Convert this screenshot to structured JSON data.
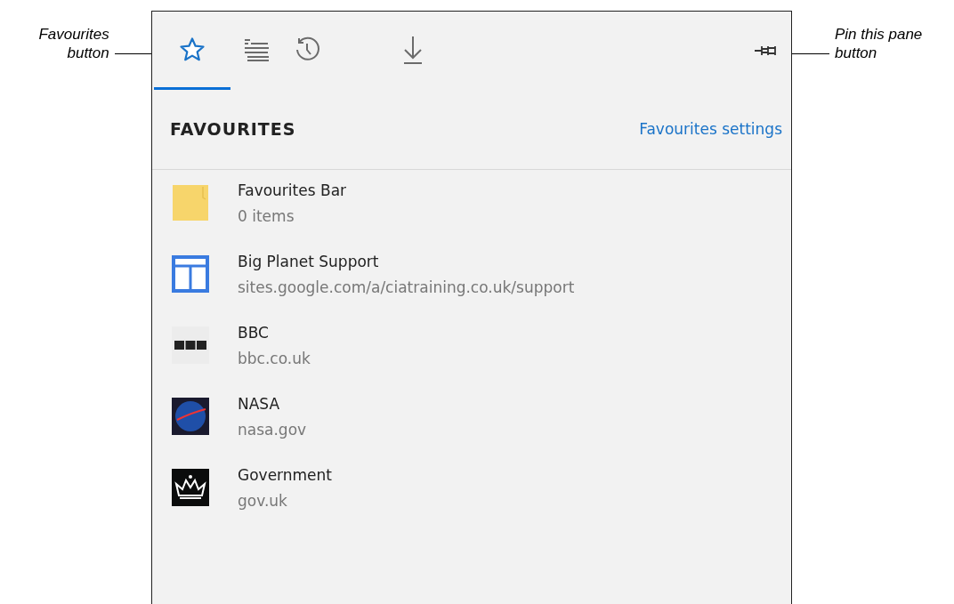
{
  "callouts": [
    {
      "kind": "left",
      "text": "Favourites button"
    },
    {
      "kind": "right",
      "text": "Pin this pane button"
    }
  ],
  "tabs": [
    {
      "kind": "favourites",
      "selected": true
    },
    {
      "kind": "reading-list",
      "selected": false
    },
    {
      "kind": "history",
      "selected": false
    },
    {
      "kind": "downloads",
      "selected": false
    }
  ],
  "pane": {
    "title": "FAVOURITES",
    "settings_link": "Favourites settings"
  },
  "items": [
    {
      "kind": "folder",
      "title": "Favourites Bar",
      "subtitle": "0 items"
    },
    {
      "kind": "layout",
      "title": "Big Planet Support",
      "subtitle": "sites.google.com/a/ciatraining.co.uk/support"
    },
    {
      "kind": "blocks",
      "title": "BBC",
      "subtitle": "bbc.co.uk"
    },
    {
      "kind": "globe",
      "title": "NASA",
      "subtitle": "nasa.gov"
    },
    {
      "kind": "crown",
      "title": "Government",
      "subtitle": "gov.uk"
    }
  ]
}
